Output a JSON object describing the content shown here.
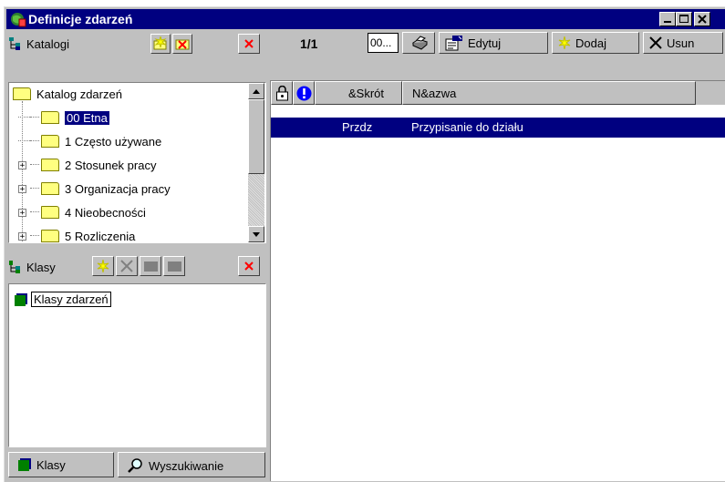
{
  "window": {
    "title": "Definicje zdarzeń",
    "controls": [
      "minimize-icon",
      "maximize-icon",
      "close-icon"
    ]
  },
  "katalogi": {
    "label": "Katalogi",
    "tree": [
      {
        "label": "Katalog zdarzeń",
        "level": 0,
        "expander": "",
        "selected": false
      },
      {
        "label": "00 Etna",
        "level": 1,
        "expander": "",
        "selected": true
      },
      {
        "label": "1 Często używane",
        "level": 1,
        "expander": "",
        "selected": false
      },
      {
        "label": "2 Stosunek pracy",
        "level": 1,
        "expander": "+",
        "selected": false
      },
      {
        "label": "3 Organizacja pracy",
        "level": 1,
        "expander": "+",
        "selected": false
      },
      {
        "label": "4 Nieobecności",
        "level": 1,
        "expander": "+",
        "selected": false
      },
      {
        "label": "5 Rozliczenia",
        "level": 1,
        "expander": "+",
        "selected": false
      }
    ]
  },
  "klasy": {
    "label": "Klasy",
    "tree": [
      {
        "label": "Klasy zdarzeń"
      }
    ]
  },
  "bottom_tabs": {
    "klasy": "Klasy",
    "wyszukiwanie": "Wyszukiwanie"
  },
  "toolbar": {
    "page_counter": "1/1",
    "page_input": "00...",
    "edit_label": "Edytuj",
    "add_label": "Dodaj",
    "delete_label": "Usun"
  },
  "table": {
    "columns": [
      "&Skrót",
      "N&azwa"
    ],
    "rows": [
      {
        "skrot": "Przdz",
        "nazwa": "Przypisanie do działu",
        "selected": true
      }
    ]
  },
  "colors": {
    "title_bar": "#000080",
    "face": "#c0c0c0",
    "selection": "#000080",
    "folder": "#ffff80",
    "delete_x": "#ff0000"
  }
}
